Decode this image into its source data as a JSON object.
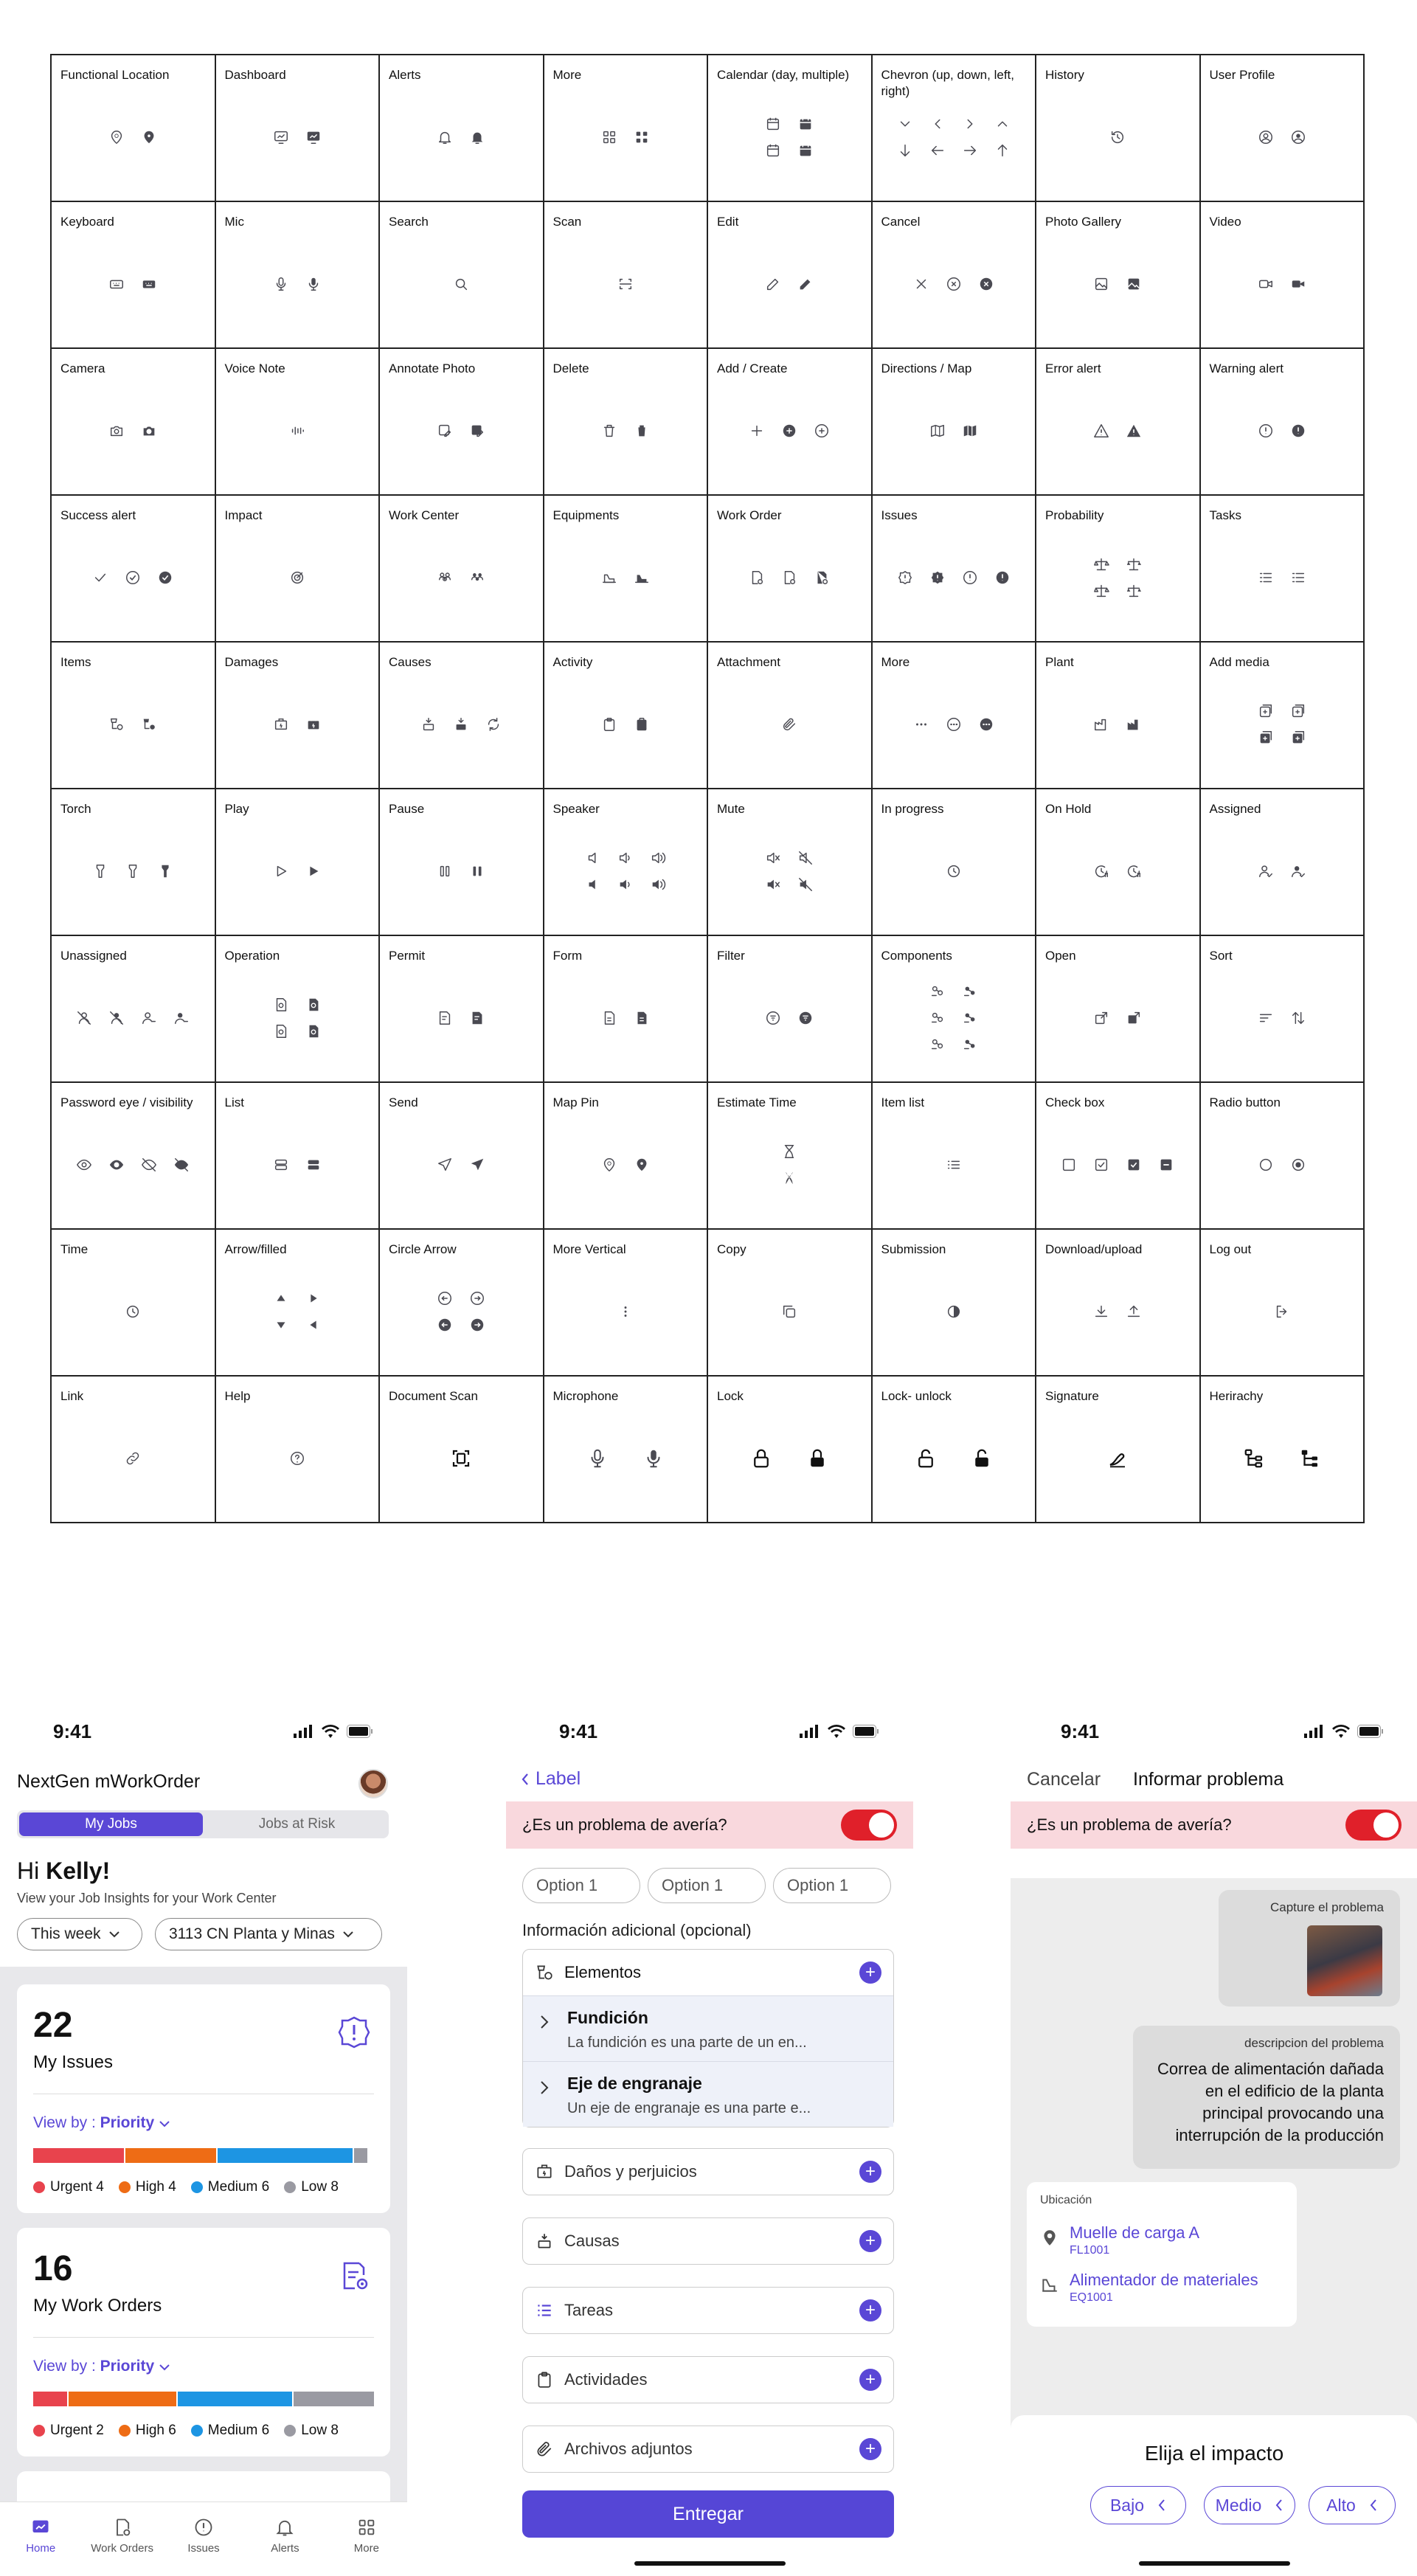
{
  "icon_grid": [
    {
      "label": "Functional Location",
      "icons": [
        "location-settings-outline-icon",
        "location-settings-filled-icon"
      ],
      "cols": 2
    },
    {
      "label": "Dashboard",
      "icons": [
        "dashboard-outline-icon",
        "dashboard-filled-icon"
      ],
      "cols": 2
    },
    {
      "label": "Alerts",
      "icons": [
        "bell-outline-icon",
        "bell-filled-icon"
      ],
      "cols": 2
    },
    {
      "label": "More",
      "icons": [
        "grid-outline-icon",
        "grid-filled-icon"
      ],
      "cols": 2
    },
    {
      "label": "Calendar (day, multiple)",
      "icons": [
        "calendar-day-outline-icon",
        "calendar-day-filled-icon",
        "calendar-multi-outline-icon",
        "calendar-multi-filled-icon"
      ],
      "cols": 2
    },
    {
      "label": "Chevron (up, down, left, right)",
      "icons": [
        "chevron-down-icon",
        "chevron-left-icon",
        "chevron-right-icon",
        "chevron-up-icon",
        "arrow-down-icon",
        "arrow-left-icon",
        "arrow-right-icon",
        "arrow-up-icon"
      ],
      "cols": 4
    },
    {
      "label": "History",
      "icons": [
        "history-icon"
      ],
      "cols": 1
    },
    {
      "label": "User Profile",
      "icons": [
        "user-circle-outline-icon",
        "user-circle-filled-icon"
      ],
      "cols": 2
    },
    {
      "label": "Keyboard",
      "icons": [
        "keyboard-outline-icon",
        "keyboard-filled-icon"
      ],
      "cols": 2
    },
    {
      "label": "Mic",
      "icons": [
        "mic-outline-icon",
        "mic-filled-icon"
      ],
      "cols": 2
    },
    {
      "label": "Search",
      "icons": [
        "search-icon"
      ],
      "cols": 1
    },
    {
      "label": "Scan",
      "icons": [
        "scan-icon"
      ],
      "cols": 1
    },
    {
      "label": "Edit",
      "icons": [
        "edit-outline-icon",
        "edit-filled-icon"
      ],
      "cols": 2
    },
    {
      "label": "Cancel",
      "icons": [
        "x-icon",
        "x-circle-outline-icon",
        "x-circle-filled-icon"
      ],
      "cols": 3
    },
    {
      "label": "Photo Gallery",
      "icons": [
        "image-outline-icon",
        "image-filled-icon"
      ],
      "cols": 2
    },
    {
      "label": "Video",
      "icons": [
        "video-outline-icon",
        "video-filled-icon"
      ],
      "cols": 2
    },
    {
      "label": "Camera",
      "icons": [
        "camera-outline-icon",
        "camera-filled-icon"
      ],
      "cols": 2
    },
    {
      "label": "Voice Note",
      "icons": [
        "waveform-icon"
      ],
      "cols": 1
    },
    {
      "label": "Annotate Photo",
      "icons": [
        "annotate-photo-outline-icon",
        "annotate-photo-filled-icon"
      ],
      "cols": 2
    },
    {
      "label": "Delete",
      "icons": [
        "trash-outline-icon",
        "trash-filled-icon"
      ],
      "cols": 2
    },
    {
      "label": "Add / Create",
      "icons": [
        "plus-icon",
        "plus-circle-filled-icon",
        "plus-circle-outline-icon"
      ],
      "cols": 3
    },
    {
      "label": "Directions / Map",
      "icons": [
        "map-outline-icon",
        "map-filled-icon"
      ],
      "cols": 2
    },
    {
      "label": "Error alert",
      "icons": [
        "warning-triangle-outline-icon",
        "warning-triangle-filled-icon"
      ],
      "cols": 2
    },
    {
      "label": "Warning alert",
      "icons": [
        "info-circle-outline-icon",
        "info-circle-filled-icon"
      ],
      "cols": 2
    },
    {
      "label": "Success alert",
      "icons": [
        "check-icon",
        "check-circle-outline-icon",
        "check-circle-filled-icon"
      ],
      "cols": 3
    },
    {
      "label": "Impact",
      "icons": [
        "target-icon"
      ],
      "cols": 1
    },
    {
      "label": "Work Center",
      "icons": [
        "people-outline-icon",
        "people-filled-icon"
      ],
      "cols": 2
    },
    {
      "label": "Equipments",
      "icons": [
        "equipment-outline-icon",
        "equipment-filled-icon"
      ],
      "cols": 2
    },
    {
      "label": "Work Order",
      "icons": [
        "work-order-outline-icon",
        "work-order-half-icon",
        "work-order-filled-icon"
      ],
      "cols": 3
    },
    {
      "label": "Issues",
      "icons": [
        "issue-outline-icon",
        "issue-filled-icon",
        "issue-circle-outline-icon",
        "issue-circle-filled-icon"
      ],
      "cols": 4
    },
    {
      "label": "Probability",
      "icons": [
        "scale-outline-icon",
        "scale-filled-icon",
        "scale-outline-alt-icon",
        "scale-filled-alt-icon"
      ],
      "cols": 2
    },
    {
      "label": "Tasks",
      "icons": [
        "task-list-outline-icon",
        "task-list-filled-icon"
      ],
      "cols": 2
    },
    {
      "label": "Items",
      "icons": [
        "items-outline-icon",
        "items-filled-icon"
      ],
      "cols": 2
    },
    {
      "label": "Damages",
      "icons": [
        "damage-outline-icon",
        "damage-filled-icon"
      ],
      "cols": 2
    },
    {
      "label": "Causes",
      "icons": [
        "cause-outline-icon",
        "cause-filled-icon",
        "cause-cycle-icon"
      ],
      "cols": 3
    },
    {
      "label": "Activity",
      "icons": [
        "clipboard-outline-icon",
        "clipboard-filled-icon"
      ],
      "cols": 2
    },
    {
      "label": "Attachment",
      "icons": [
        "paperclip-icon"
      ],
      "cols": 1
    },
    {
      "label": "More",
      "icons": [
        "more-horizontal-icon",
        "more-circle-outline-icon",
        "more-circle-filled-icon"
      ],
      "cols": 3
    },
    {
      "label": "Plant",
      "icons": [
        "factory-outline-icon",
        "factory-filled-icon"
      ],
      "cols": 2
    },
    {
      "label": "Add media",
      "icons": [
        "add-media-outline-icon",
        "add-media-stack-outline-icon",
        "add-media-filled-icon",
        "add-media-stack-filled-icon"
      ],
      "cols": 2
    },
    {
      "label": "Torch",
      "icons": [
        "torch-outline-icon",
        "torch-half-icon",
        "torch-filled-icon"
      ],
      "cols": 3
    },
    {
      "label": "Play",
      "icons": [
        "play-outline-icon",
        "play-filled-icon"
      ],
      "cols": 2
    },
    {
      "label": "Pause",
      "icons": [
        "pause-outline-icon",
        "pause-filled-icon"
      ],
      "cols": 2
    },
    {
      "label": "Speaker",
      "icons": [
        "speaker-outline-icon",
        "speaker-low-outline-icon",
        "speaker-high-outline-icon",
        "speaker-filled-icon",
        "speaker-low-filled-icon",
        "speaker-high-filled-icon"
      ],
      "cols": 3
    },
    {
      "label": "Mute",
      "icons": [
        "mute-outline-icon",
        "mute-slash-outline-icon",
        "mute-filled-icon",
        "mute-slash-filled-icon"
      ],
      "cols": 2
    },
    {
      "label": "In progress",
      "icons": [
        "clock-icon"
      ],
      "cols": 1
    },
    {
      "label": "On Hold",
      "icons": [
        "clock-hold-outline-icon",
        "clock-hold-alt-icon"
      ],
      "cols": 2
    },
    {
      "label": "Assigned",
      "icons": [
        "user-assigned-outline-icon",
        "user-assigned-filled-icon"
      ],
      "cols": 2
    },
    {
      "label": "Unassigned",
      "icons": [
        "user-off-outline-icon",
        "user-off-filled-icon",
        "user-unassigned-outline-icon",
        "user-unassigned-filled-icon"
      ],
      "cols": 4
    },
    {
      "label": "Operation",
      "icons": [
        "operation-outline-icon",
        "operation-filled-icon",
        "operation-gear-outline-icon",
        "operation-gear-filled-icon"
      ],
      "cols": 2
    },
    {
      "label": "Permit",
      "icons": [
        "permit-outline-icon",
        "permit-filled-icon"
      ],
      "cols": 2
    },
    {
      "label": "Form",
      "icons": [
        "form-outline-icon",
        "form-filled-icon"
      ],
      "cols": 2
    },
    {
      "label": "Filter",
      "icons": [
        "filter-circle-outline-icon",
        "filter-circle-filled-icon"
      ],
      "cols": 2
    },
    {
      "label": "Components",
      "icons": [
        "component-outline-icon",
        "component-filled-icon",
        "component-outline-alt-icon",
        "component-filled-alt-icon",
        "component-outline-alt2-icon",
        "component-filled-alt2-icon"
      ],
      "cols": 2
    },
    {
      "label": "Open",
      "icons": [
        "open-outline-icon",
        "open-filled-icon"
      ],
      "cols": 2
    },
    {
      "label": "Sort",
      "icons": [
        "sort-lines-icon",
        "sort-arrows-icon"
      ],
      "cols": 2
    },
    {
      "label": "Password eye / visibility",
      "icons": [
        "eye-outline-icon",
        "eye-filled-icon",
        "eye-off-outline-icon",
        "eye-off-filled-icon"
      ],
      "cols": 4
    },
    {
      "label": "List",
      "icons": [
        "list-rows-outline-icon",
        "list-rows-filled-icon"
      ],
      "cols": 2
    },
    {
      "label": "Send",
      "icons": [
        "send-outline-icon",
        "send-filled-icon"
      ],
      "cols": 2
    },
    {
      "label": "Map Pin",
      "icons": [
        "map-pin-outline-icon",
        "map-pin-filled-icon"
      ],
      "cols": 2
    },
    {
      "label": "Estimate Time",
      "icons": [
        "hourglass-outline-icon",
        "hourglass-filled-icon"
      ],
      "cols": 1
    },
    {
      "label": "Item list",
      "icons": [
        "bullet-list-icon"
      ],
      "cols": 1
    },
    {
      "label": "Check box",
      "icons": [
        "checkbox-empty-icon",
        "checkbox-checked-outline-icon",
        "checkbox-checked-filled-icon",
        "checkbox-indeterminate-icon"
      ],
      "cols": 4
    },
    {
      "label": "Radio button",
      "icons": [
        "radio-empty-icon",
        "radio-selected-icon"
      ],
      "cols": 2
    },
    {
      "label": "Time",
      "icons": [
        "clock-icon"
      ],
      "cols": 1
    },
    {
      "label": "Arrow/filled",
      "icons": [
        "triangle-up-icon",
        "triangle-right-icon",
        "triangle-down-icon",
        "triangle-left-icon"
      ],
      "cols": 2
    },
    {
      "label": "Circle Arrow",
      "icons": [
        "circle-arrow-left-outline-icon",
        "circle-arrow-right-outline-icon",
        "circle-arrow-left-filled-icon",
        "circle-arrow-right-filled-icon"
      ],
      "cols": 2
    },
    {
      "label": "More Vertical",
      "icons": [
        "more-vertical-icon"
      ],
      "cols": 1
    },
    {
      "label": "Copy",
      "icons": [
        "copy-icon"
      ],
      "cols": 1
    },
    {
      "label": "Submission",
      "icons": [
        "half-circle-icon"
      ],
      "cols": 1
    },
    {
      "label": "Download/upload",
      "icons": [
        "download-icon",
        "upload-icon"
      ],
      "cols": 2
    },
    {
      "label": "Log out",
      "icons": [
        "logout-icon"
      ],
      "cols": 1
    },
    {
      "label": "Link",
      "icons": [
        "link-icon"
      ],
      "cols": 1
    },
    {
      "label": "Help",
      "icons": [
        "help-circle-icon"
      ],
      "cols": 1
    },
    {
      "label": "Document Scan",
      "icons": [
        "document-scan-icon"
      ],
      "cols": 1,
      "big": true
    },
    {
      "label": "Microphone",
      "icons": [
        "mic-outline-icon",
        "mic-filled-icon"
      ],
      "cols": 2,
      "big": true
    },
    {
      "label": "Lock",
      "icons": [
        "lock-outline-icon",
        "lock-filled-icon"
      ],
      "cols": 2,
      "big": true
    },
    {
      "label": "Lock- unlock",
      "icons": [
        "unlock-outline-icon",
        "unlock-filled-icon"
      ],
      "cols": 2,
      "big": true
    },
    {
      "label": "Signature",
      "icons": [
        "signature-icon"
      ],
      "cols": 1,
      "big": true
    },
    {
      "label": "Herirachy",
      "icons": [
        "hierarchy-outline-icon",
        "hierarchy-filled-icon"
      ],
      "cols": 2,
      "big": true
    }
  ],
  "status_time": "9:41",
  "home": {
    "app_title": "NextGen mWorkOrder",
    "segment": {
      "my_jobs": "My Jobs",
      "jobs_at_risk": "Jobs at Risk"
    },
    "greeting": "Hi ",
    "user_name": "Kelly!",
    "subtitle": "View your Job Insights for your Work Center",
    "filter_period": "This week",
    "filter_center": "3113 CN Planta y Minas",
    "view_by_prefix": "View by : ",
    "view_by_value": "Priority",
    "issues_card": {
      "count": "22",
      "title": "My Issues",
      "legend": [
        {
          "label": "Urgent 4",
          "color": "#e8434d"
        },
        {
          "label": "High 4",
          "color": "#ee6c15"
        },
        {
          "label": "Medium 6",
          "color": "#1d95e3"
        },
        {
          "label": "Low 8",
          "color": "#9a9aa2"
        }
      ],
      "bar_fractions": [
        0.27,
        0.27,
        0.4,
        0.04
      ]
    },
    "orders_card": {
      "count": "16",
      "title": "My Work Orders",
      "legend": [
        {
          "label": "Urgent 2",
          "color": "#e8434d"
        },
        {
          "label": "High 6",
          "color": "#ee6c15"
        },
        {
          "label": "Medium 6",
          "color": "#1d95e3"
        },
        {
          "label": "Low 8",
          "color": "#9a9aa2"
        }
      ],
      "bar_fractions": [
        0.1,
        0.32,
        0.34,
        0.24
      ]
    },
    "tabs": [
      {
        "label": "Home",
        "icon": "home-chart-icon",
        "active": true
      },
      {
        "label": "Work Orders",
        "icon": "work-order-icon",
        "active": false
      },
      {
        "label": "Issues",
        "icon": "issue-icon",
        "active": false
      },
      {
        "label": "Alerts",
        "icon": "bell-icon",
        "active": false
      },
      {
        "label": "More",
        "icon": "grid-icon",
        "active": false
      }
    ]
  },
  "form": {
    "back_label": "Label",
    "breakdown_question": "¿Es un problema de avería?",
    "options": [
      "Option 1",
      "Option 1",
      "Option 1"
    ],
    "additional_info": "Información adicional (opcional)",
    "elementos": "Elementos",
    "items": [
      {
        "title": "Fundición",
        "desc": "La fundición es una parte de un en..."
      },
      {
        "title": "Eje de engranaje",
        "desc": "Un eje de engranaje es una parte e..."
      }
    ],
    "sections": [
      "Daños y perjuicios",
      "Causas",
      "Tareas",
      "Actividades",
      "Archivos adjuntos"
    ],
    "submit": "Entregar"
  },
  "report": {
    "cancel": "Cancelar",
    "title": "Informar problema",
    "breakdown_question": "¿Es un problema de avería?",
    "capture_label": "Capture el problema",
    "desc_label": "descripcion del problema",
    "desc_text": "Correa de alimentación dañada en el edificio de la planta principal provocando una interrupción de la producción",
    "location_label": "Ubicación",
    "location": [
      {
        "name": "Muelle de carga A",
        "code": "FL1001"
      },
      {
        "name": "Alimentador de materiales",
        "code": "EQ1001"
      }
    ],
    "impact_title": "Elija el impacto",
    "impact_options": [
      "Bajo",
      "Medio",
      "Alto"
    ]
  },
  "colors": {
    "primary": "#5a47d6",
    "toggle_red": "#e0202a",
    "alert_bg": "#f9d8dd"
  }
}
